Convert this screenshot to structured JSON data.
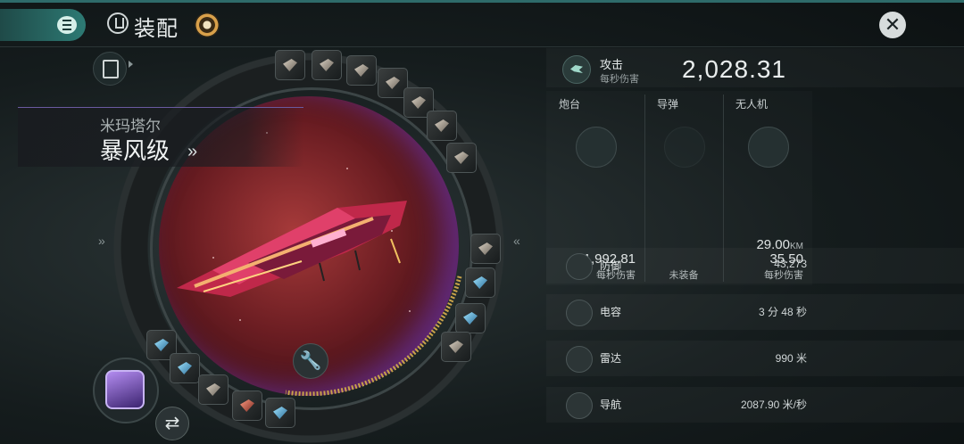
{
  "header": {
    "title": "装配",
    "close_icon": "close-icon",
    "menu_icon": "menu-icon"
  },
  "ship": {
    "faction": "米玛塔尔",
    "name": "暴风级",
    "name_arrow": "»"
  },
  "ring": {
    "left_chevron": "»",
    "right_chevron": "«"
  },
  "attack": {
    "label": "攻击",
    "sub": "每秒伤害",
    "value": "2,028.31"
  },
  "weapons": [
    {
      "title": "炮台",
      "value": "1,992.81",
      "unit": "每秒伤害"
    },
    {
      "title": "导弹",
      "status": "未装备"
    },
    {
      "title": "无人机",
      "range": "29.00",
      "range_unit": "KM",
      "value": "35.50",
      "unit": "每秒伤害"
    }
  ],
  "stats": [
    {
      "label": "防御",
      "value": "43,273",
      "icon": "shield-icon"
    },
    {
      "label": "电容",
      "value": "3 分 48 秒",
      "icon": "capacitor-icon"
    },
    {
      "label": "雷达",
      "value": "990 米",
      "icon": "radar-icon"
    },
    {
      "label": "导航",
      "value": "2087.90 米/秒",
      "icon": "navigation-icon"
    }
  ],
  "colors": {
    "accent": "#2d7a74",
    "ship_bg": "#6b1d22",
    "ring_track": "#c8a24a"
  }
}
